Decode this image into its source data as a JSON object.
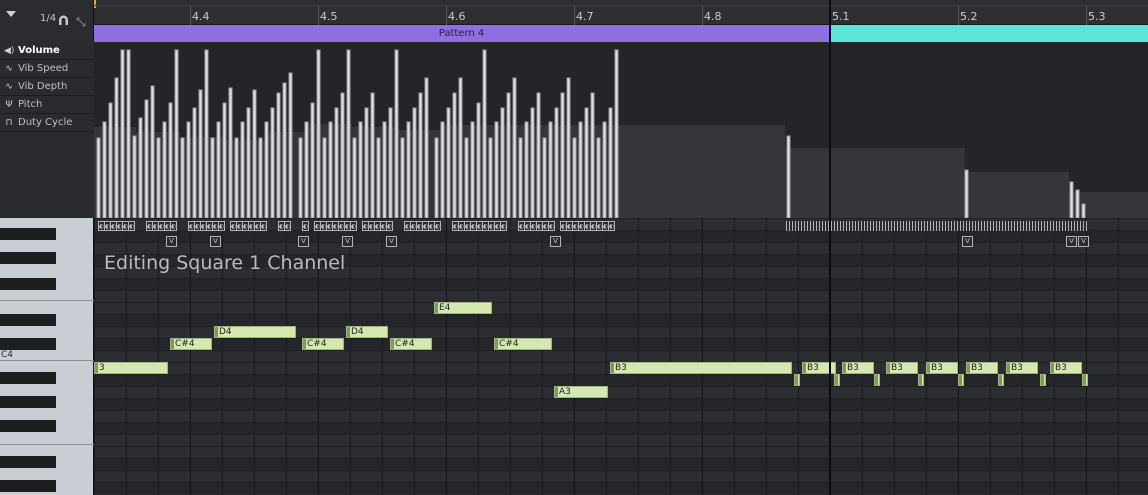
{
  "toolbar": {
    "snap": "1/4"
  },
  "ruler": {
    "labels": [
      "4.4",
      "4.5",
      "4.6",
      "4.7",
      "4.8",
      "5.1",
      "5.2",
      "5.3"
    ]
  },
  "patterns": [
    {
      "label": "Pattern 4",
      "color": "#8f6ee0"
    },
    {
      "label": "",
      "color": "#5ce5d6"
    }
  ],
  "lanes": [
    {
      "icon": "speaker-icon",
      "label": "Volume"
    },
    {
      "icon": "wave-icon",
      "label": "Vib Speed"
    },
    {
      "icon": "wave-icon",
      "label": "Vib Depth"
    },
    {
      "icon": "fork-icon",
      "label": "Pitch"
    },
    {
      "icon": "square-wave-icon",
      "label": "Duty Cycle"
    }
  ],
  "channel_label": "Editing Square 1 Channel",
  "piano": {
    "c4_label": "C4"
  },
  "notes": [
    {
      "pitch": "E4",
      "label": "E4"
    },
    {
      "pitch": "D4",
      "label": "D4"
    },
    {
      "pitch": "D4",
      "label": "D4"
    },
    {
      "pitch": "C#4",
      "label": "C#4"
    },
    {
      "pitch": "C#4",
      "label": "C#4"
    },
    {
      "pitch": "C#4",
      "label": "C#4"
    },
    {
      "pitch": "C#4",
      "label": "C#4"
    },
    {
      "pitch": "B3",
      "label": "3"
    },
    {
      "pitch": "B3",
      "label": "B3"
    },
    {
      "pitch": "B3",
      "label": "B3"
    },
    {
      "pitch": "B3",
      "label": "B3"
    },
    {
      "pitch": "B3",
      "label": "B3"
    },
    {
      "pitch": "B3",
      "label": "B3"
    },
    {
      "pitch": "B3",
      "label": "B3"
    },
    {
      "pitch": "B3",
      "label": "B3"
    },
    {
      "pitch": "B3",
      "label": "B3"
    },
    {
      "pitch": "A3",
      "label": "A3"
    }
  ],
  "colors": {
    "accent_pattern4": "#8f6ee0",
    "accent_pattern5": "#5ce5d6",
    "note_fill": "#d5e8b2"
  }
}
